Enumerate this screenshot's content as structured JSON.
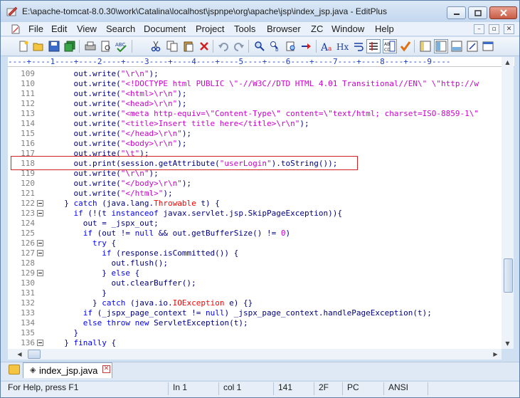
{
  "window": {
    "title": "E:\\apache-tomcat-8.0.30\\work\\Catalina\\localhost\\jspnpe\\org\\apache\\jsp\\index_jsp.java - EditPlus"
  },
  "menu": [
    "File",
    "Edit",
    "View",
    "Search",
    "Document",
    "Project",
    "Tools",
    "Browser",
    "ZC",
    "Window",
    "Help"
  ],
  "ruler": {
    "text": "----+----1----+----2----+----3----+----4----+----5----+----6----+----7----+----8----+----9----"
  },
  "editor": {
    "lines": [
      {
        "n": "109",
        "fold": false,
        "tokens": [
          [
            "n",
            "    out.write("
          ],
          [
            "s",
            "\"\\r\\n\""
          ],
          [
            "n",
            ");"
          ]
        ]
      },
      {
        "n": "110",
        "fold": false,
        "tokens": [
          [
            "n",
            "    out.write("
          ],
          [
            "s",
            "\"<!DOCTYPE html PUBLIC \\\"-//W3C//DTD HTML 4.01 Transitional//EN\\\" \\\"http://w"
          ]
        ]
      },
      {
        "n": "111",
        "fold": false,
        "tokens": [
          [
            "n",
            "    out.write("
          ],
          [
            "s",
            "\"<html>\\r\\n\""
          ],
          [
            "n",
            ");"
          ]
        ]
      },
      {
        "n": "112",
        "fold": false,
        "tokens": [
          [
            "n",
            "    out.write("
          ],
          [
            "s",
            "\"<head>\\r\\n\""
          ],
          [
            "n",
            ");"
          ]
        ]
      },
      {
        "n": "113",
        "fold": false,
        "tokens": [
          [
            "n",
            "    out.write("
          ],
          [
            "s",
            "\"<meta http-equiv=\\\"Content-Type\\\" content=\\\"text/html; charset=ISO-8859-1\\\""
          ]
        ]
      },
      {
        "n": "114",
        "fold": false,
        "tokens": [
          [
            "n",
            "    out.write("
          ],
          [
            "s",
            "\"<title>Insert title here</title>\\r\\n\""
          ],
          [
            "n",
            ");"
          ]
        ]
      },
      {
        "n": "115",
        "fold": false,
        "tokens": [
          [
            "n",
            "    out.write("
          ],
          [
            "s",
            "\"</head>\\r\\n\""
          ],
          [
            "n",
            ");"
          ]
        ]
      },
      {
        "n": "116",
        "fold": false,
        "tokens": [
          [
            "n",
            "    out.write("
          ],
          [
            "s",
            "\"<body>\\r\\n\""
          ],
          [
            "n",
            ");"
          ]
        ]
      },
      {
        "n": "117",
        "fold": false,
        "tokens": [
          [
            "n",
            "    out.write("
          ],
          [
            "s",
            "\"\\t\""
          ],
          [
            "n",
            ");"
          ]
        ]
      },
      {
        "n": "118",
        "fold": false,
        "tokens": [
          [
            "n",
            "    out.print(session.getAttribute("
          ],
          [
            "s",
            "\"userLogin\""
          ],
          [
            "n",
            ").toString());"
          ]
        ]
      },
      {
        "n": "119",
        "fold": false,
        "tokens": [
          [
            "n",
            "    out.write("
          ],
          [
            "s",
            "\"\\r\\n\""
          ],
          [
            "n",
            ");"
          ]
        ]
      },
      {
        "n": "120",
        "fold": false,
        "tokens": [
          [
            "n",
            "    out.write("
          ],
          [
            "s",
            "\"</body>\\r\\n\""
          ],
          [
            "n",
            ");"
          ]
        ]
      },
      {
        "n": "121",
        "fold": false,
        "tokens": [
          [
            "n",
            "    out.write("
          ],
          [
            "s",
            "\"</html>\""
          ],
          [
            "n",
            ");"
          ]
        ]
      },
      {
        "n": "122",
        "fold": true,
        "tokens": [
          [
            "n",
            "  } "
          ],
          [
            "k",
            "catch"
          ],
          [
            "n",
            " (java.lang."
          ],
          [
            "t",
            "Throwable"
          ],
          [
            "n",
            " t) {"
          ]
        ]
      },
      {
        "n": "123",
        "fold": true,
        "tokens": [
          [
            "n",
            "    "
          ],
          [
            "k",
            "if"
          ],
          [
            "n",
            " (!(t "
          ],
          [
            "k",
            "instanceof"
          ],
          [
            "n",
            " javax.servlet.jsp.SkipPageException)){"
          ]
        ]
      },
      {
        "n": "124",
        "fold": false,
        "tokens": [
          [
            "n",
            "      out = _jspx_out;"
          ]
        ]
      },
      {
        "n": "125",
        "fold": false,
        "tokens": [
          [
            "n",
            "      "
          ],
          [
            "k",
            "if"
          ],
          [
            "n",
            " (out != "
          ],
          [
            "k",
            "null"
          ],
          [
            "n",
            " && out.getBufferSize() != "
          ],
          [
            "s",
            "0"
          ],
          [
            "n",
            ")"
          ]
        ]
      },
      {
        "n": "126",
        "fold": true,
        "tokens": [
          [
            "n",
            "        "
          ],
          [
            "k",
            "try"
          ],
          [
            "n",
            " {"
          ]
        ]
      },
      {
        "n": "127",
        "fold": true,
        "tokens": [
          [
            "n",
            "          "
          ],
          [
            "k",
            "if"
          ],
          [
            "n",
            " (response.isCommitted()) {"
          ]
        ]
      },
      {
        "n": "128",
        "fold": false,
        "tokens": [
          [
            "n",
            "            out.flush();"
          ]
        ]
      },
      {
        "n": "129",
        "fold": true,
        "tokens": [
          [
            "n",
            "          } "
          ],
          [
            "k",
            "else"
          ],
          [
            "n",
            " {"
          ]
        ]
      },
      {
        "n": "130",
        "fold": false,
        "tokens": [
          [
            "n",
            "            out.clearBuffer();"
          ]
        ]
      },
      {
        "n": "131",
        "fold": false,
        "tokens": [
          [
            "n",
            "          }"
          ]
        ]
      },
      {
        "n": "132",
        "fold": false,
        "tokens": [
          [
            "n",
            "        } "
          ],
          [
            "k",
            "catch"
          ],
          [
            "n",
            " (java.io."
          ],
          [
            "t",
            "IOException"
          ],
          [
            "n",
            " e) {}"
          ]
        ]
      },
      {
        "n": "133",
        "fold": false,
        "tokens": [
          [
            "n",
            "      "
          ],
          [
            "k",
            "if"
          ],
          [
            "n",
            " (_jspx_page_context != "
          ],
          [
            "k",
            "null"
          ],
          [
            "n",
            ") _jspx_page_context.handlePageException(t);"
          ]
        ]
      },
      {
        "n": "134",
        "fold": false,
        "tokens": [
          [
            "n",
            "      "
          ],
          [
            "k",
            "else"
          ],
          [
            "n",
            " "
          ],
          [
            "k",
            "throw"
          ],
          [
            "n",
            " "
          ],
          [
            "k",
            "new"
          ],
          [
            "n",
            " ServletException(t);"
          ]
        ]
      },
      {
        "n": "135",
        "fold": false,
        "tokens": [
          [
            "n",
            "    }"
          ]
        ]
      },
      {
        "n": "136",
        "fold": true,
        "tokens": [
          [
            "n",
            "  } "
          ],
          [
            "k",
            "finally"
          ],
          [
            "n",
            " {"
          ]
        ]
      }
    ]
  },
  "tab": {
    "label": "index_jsp.java"
  },
  "status": {
    "help": "For Help, press F1",
    "line": "In 1",
    "col": "col 1",
    "count": "141",
    "hex": "2F",
    "eol": "PC",
    "encoding": "ANSI"
  },
  "colors": {
    "keyword": "#0000ff",
    "string": "#cc00cc",
    "type": "#ff0000",
    "code": "#000080",
    "highlight_box": "#d02020"
  },
  "toolbar_icons": [
    "new-file-icon",
    "open-file-icon",
    "save-icon",
    "save-all-icon",
    "print-icon",
    "print-preview-icon",
    "spellcheck-icon",
    "cut-icon",
    "copy-icon",
    "paste-icon",
    "delete-icon",
    "undo-icon",
    "redo-icon",
    "find-icon",
    "replace-icon",
    "find-in-files-icon",
    "goto-icon",
    "font-icon",
    "hx-icon",
    "word-wrap-icon",
    "line-number-icon",
    "column-select-icon",
    "check-icon",
    "directory-window-icon",
    "cliptext-window-icon",
    "output-window-icon",
    "fullscreen-icon",
    "browser-icon"
  ]
}
